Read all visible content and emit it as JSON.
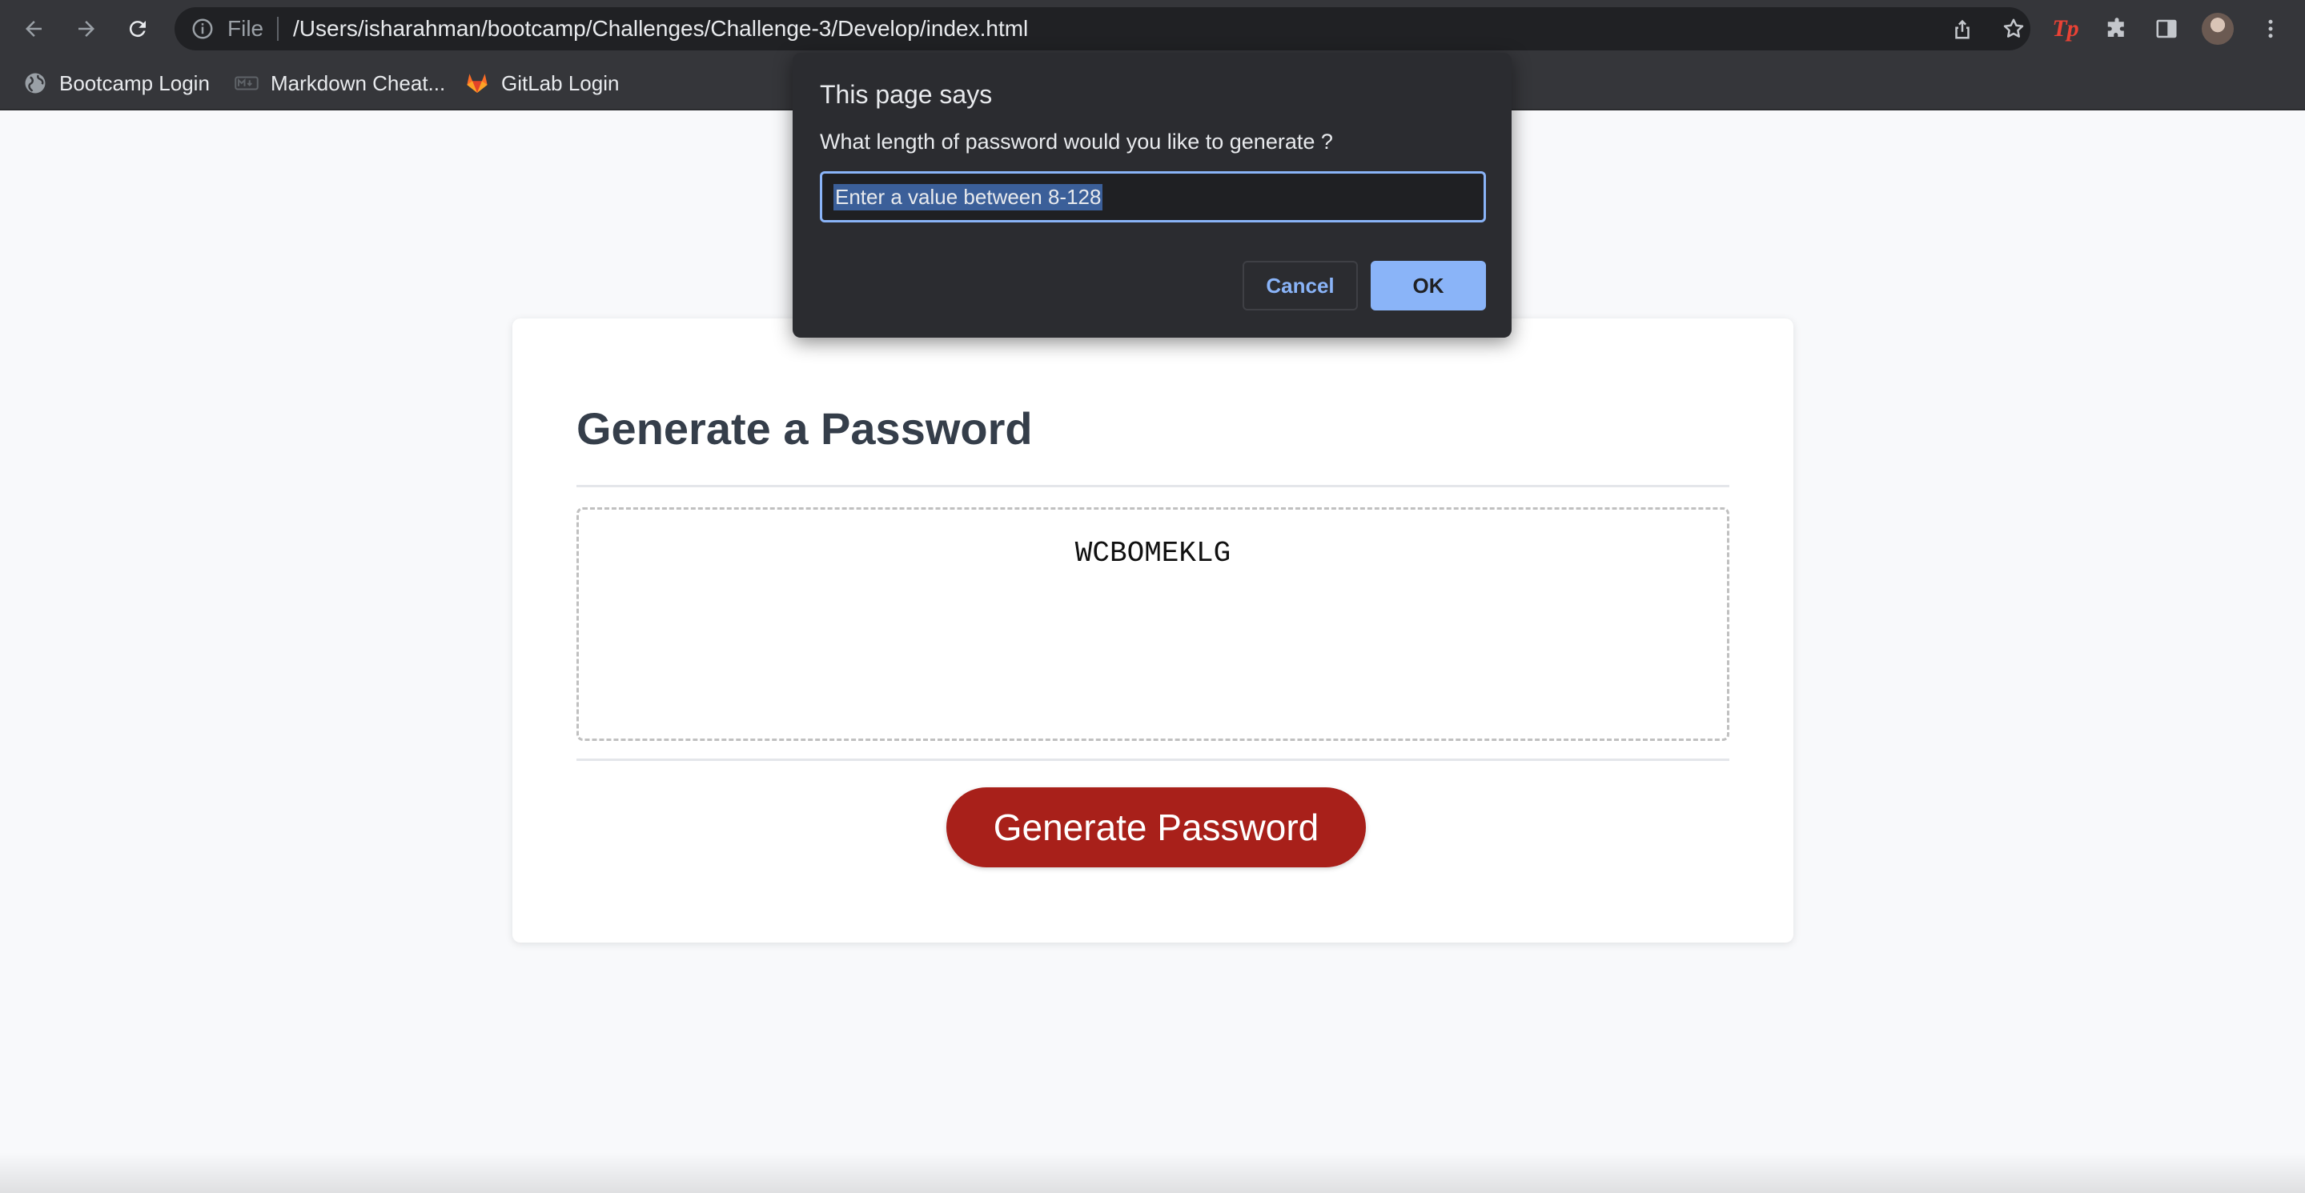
{
  "browser": {
    "scheme_label": "File",
    "url": "/Users/isharahman/bootcamp/Challenges/Challenge-3/Develop/index.html",
    "icons": [
      "back-arrow-icon",
      "forward-arrow-icon",
      "reload-icon",
      "info-icon",
      "share-icon",
      "star-icon",
      "puzzle-icon",
      "side-panel-icon",
      "kebab-menu-icon"
    ],
    "extension_label": "Tp",
    "bookmarks": [
      {
        "label": "Bootcamp Login",
        "icon": "globe-icon"
      },
      {
        "label": "Markdown Cheat...",
        "icon": "markdown-icon"
      },
      {
        "label": "GitLab Login",
        "icon": "gitlab-icon"
      }
    ]
  },
  "page": {
    "title": "Generate a Password",
    "password": "WCBOMEKLG",
    "generate_button": "Generate Password",
    "colors": {
      "button": "#a8201a",
      "title": "#353e4a"
    }
  },
  "dialog": {
    "title": "This page says",
    "message": "What length of password would you like to generate ?",
    "input_value": "Enter a value between 8-128",
    "cancel_label": "Cancel",
    "ok_label": "OK"
  }
}
